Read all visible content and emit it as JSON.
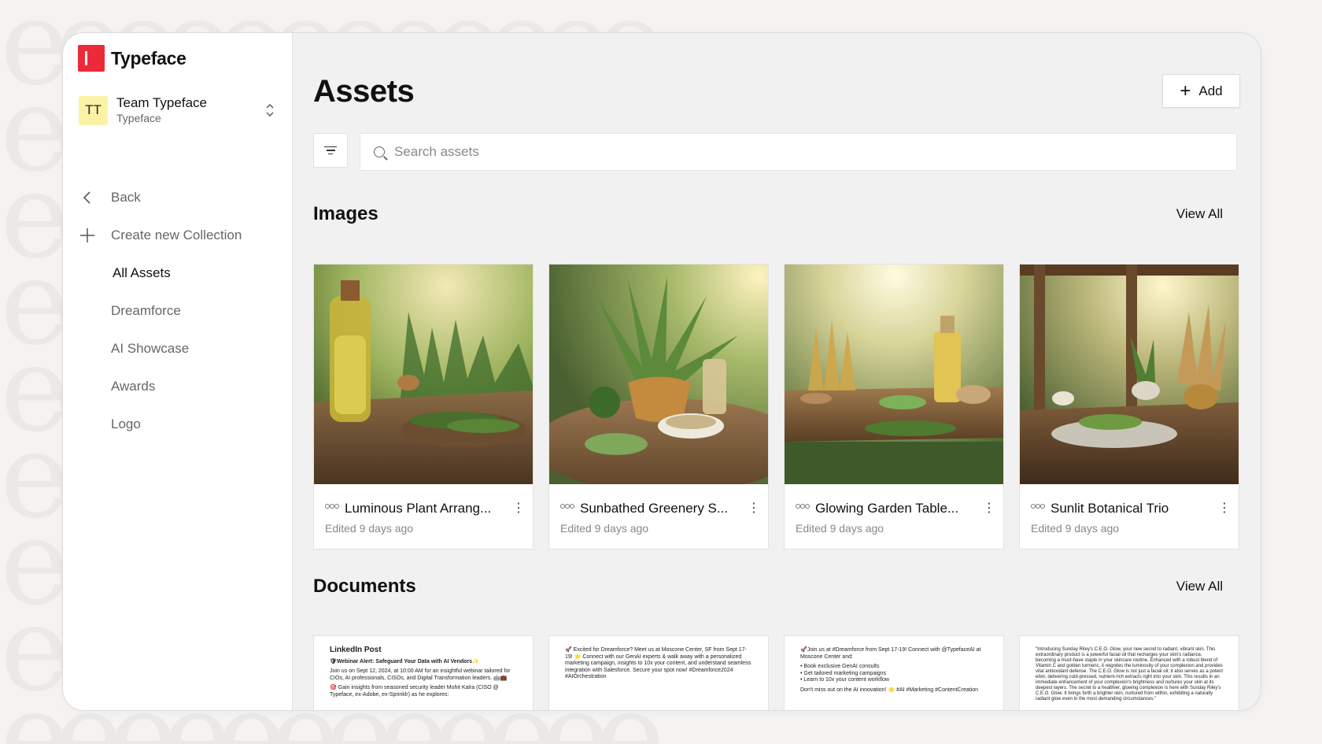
{
  "app": {
    "brand": "Typeface",
    "team": {
      "initials": "TT",
      "name": "Team Typeface",
      "sub": "Typeface"
    }
  },
  "sidebar": {
    "back": "Back",
    "create": "Create new Collection",
    "items": [
      {
        "label": "All Assets",
        "active": true
      },
      {
        "label": "Dreamforce"
      },
      {
        "label": "AI Showcase"
      },
      {
        "label": "Awards"
      },
      {
        "label": "Logo"
      }
    ]
  },
  "main": {
    "title": "Assets",
    "add_label": "Add",
    "search": {
      "placeholder": "Search assets",
      "value": ""
    },
    "images": {
      "title": "Images",
      "view_all": "View All",
      "cards": [
        {
          "name": "Luminous Plant Arrang...",
          "meta": "Edited 9 days ago"
        },
        {
          "name": "Sunbathed Greenery S...",
          "meta": "Edited 9 days ago"
        },
        {
          "name": "Glowing Garden Table...",
          "meta": "Edited 9 days ago"
        },
        {
          "name": "Sunlit Botanical Trio",
          "meta": "Edited 9 days ago"
        }
      ]
    },
    "documents": {
      "title": "Documents",
      "view_all": "View All",
      "docs": [
        {
          "heading": "LinkedIn Post",
          "lines": [
            "🛡Webinar Alert: Safeguard Your Data with AI Vendors✨",
            "Join us on Sept 12, 2024, at 10:00 AM for an insightful webinar tailored for CIOs, AI professionals, CISOs, and Digital Transformation leaders. 🤖💼",
            "🎯 Gain insights from seasoned security leader Mohit Kalra (CISO @ Typeface, ex-Adobe, ex-Sprinklr) as he explores:"
          ]
        },
        {
          "heading": "",
          "lines": [
            "🚀 Excited for Dreamforce? Meet us at Moscone Center, SF from Sept 17-19! 🌟 Connect with our GenAI experts & walk away with a personalized marketing campaign, insights to 10x your content, and understand seamless integration with Salesforce. Secure your spot now! #Dreamforce2024 #AIOrchestration"
          ]
        },
        {
          "heading": "",
          "lines": [
            "🚀Join us at #Dreamforce from Sept 17-19! Connect with @TypefaceAI at Moscone Center and:",
            "• Book exclusive GenAI consults",
            "• Get tailored marketing campaigns",
            "• Learn to 10x your content workflow",
            "Don't miss out on the AI innovation! 🌟 #AI #Marketing #ContentCreation"
          ]
        },
        {
          "heading": "",
          "lines": [
            "\"Introducing Sunday Riley's C.E.O. Glow, your new secret to radiant, vibrant skin. This extraordinary product is a powerful facial oil that recharges your skin's radiance, becoming a must-have staple in your skincare routine. Enhanced with a robust blend of Vitamin C and golden turmeric, it reignites the luminosity of your complexion and provides vital antioxidant defense. The C.E.O. Glow is not just a facial oil; it also serves as a potent elixir, delivering cold-pressed, nutrient-rich extracts right into your skin. This results in an immediate enhancement of your complexion's brightness and nurtures your skin at its deepest layers. The secret to a healthier, glowing complexion is here with Sunday Riley's C.E.O. Glow. It brings forth a brighter skin, nurtured from within, exhibiting a naturally radiant glow even in the most demanding circumstances.\""
          ]
        }
      ]
    }
  },
  "colors": {
    "brand_red": "#ec2a3a",
    "avatar_yellow": "#fcf2a6"
  }
}
